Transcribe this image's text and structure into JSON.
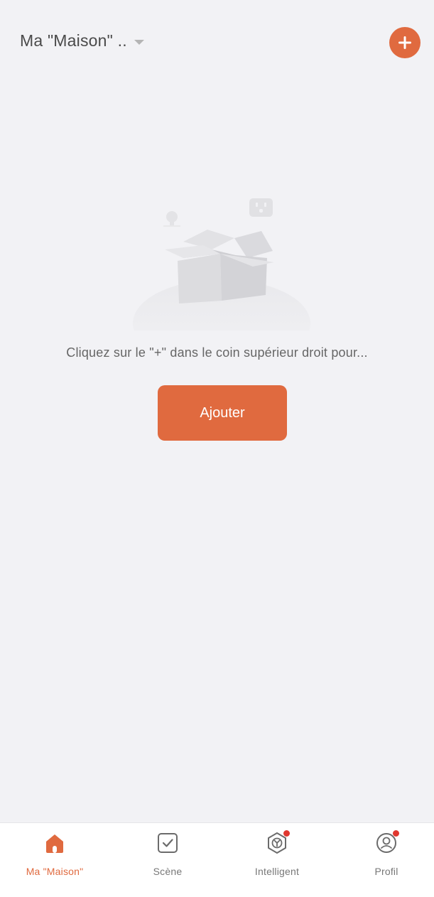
{
  "header": {
    "home_title": "Ma \"Maison\" ..",
    "add_icon": "plus-circle-icon"
  },
  "empty_state": {
    "illustration": "empty-box-illustration",
    "message": "Cliquez sur le \"+\" dans le coin supérieur droit pour...",
    "button_label": "Ajouter"
  },
  "tabbar": {
    "items": [
      {
        "label": "Ma \"Maison\"",
        "icon": "home-icon",
        "active": true,
        "badge": false
      },
      {
        "label": "Scène",
        "icon": "scene-checkbox-icon",
        "active": false,
        "badge": false
      },
      {
        "label": "Intelligent",
        "icon": "intelligent-cube-icon",
        "active": false,
        "badge": true
      },
      {
        "label": "Profil",
        "icon": "profile-icon",
        "active": false,
        "badge": true
      }
    ]
  },
  "colors": {
    "accent": "#e06a3f",
    "background": "#f2f2f5",
    "badge": "#e0372f"
  }
}
